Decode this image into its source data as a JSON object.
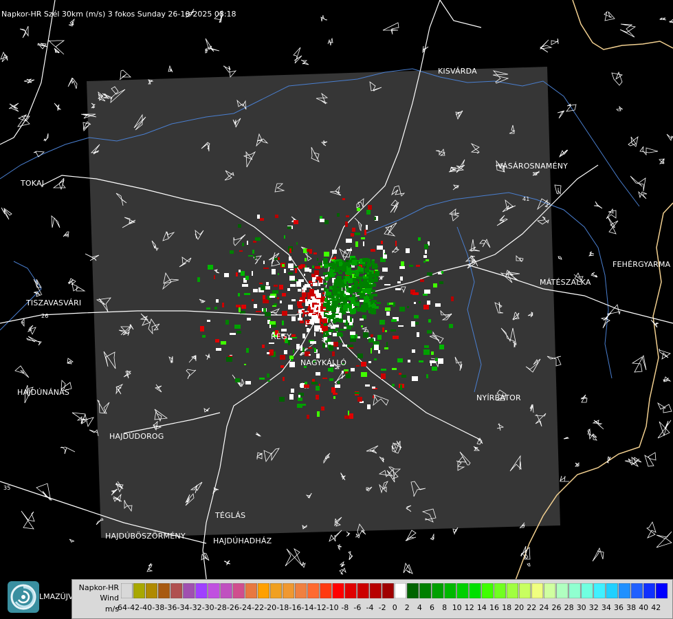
{
  "header": {
    "title": "Napkor-HR Szél 30km (m/s) 3 fokos Sunday 26-10-2025 08:18"
  },
  "places": [
    {
      "id": "kisvarda",
      "name": "KISVÁRDA"
    },
    {
      "id": "vasarosnameny",
      "name": "VÁSÁROSNAMÉNY"
    },
    {
      "id": "tokaj",
      "name": "TOKAJ"
    },
    {
      "id": "fehergyarmat",
      "name": "FEHÉRGYARMA"
    },
    {
      "id": "mateszalka",
      "name": "MÁTÉSZALKA"
    },
    {
      "id": "tiszavasvari",
      "name": "TISZAVASVÁRI"
    },
    {
      "id": "nyiregyhaza",
      "name": "REGY"
    },
    {
      "id": "nagykallo",
      "name": "NAGYKÁLLÓ"
    },
    {
      "id": "nyirbator",
      "name": "NYÍRBÁTOR"
    },
    {
      "id": "hajdunanas",
      "name": "HAJDÚNÁNÁS"
    },
    {
      "id": "hajdudorog",
      "name": "HAJDÚDOROG"
    },
    {
      "id": "teglas",
      "name": "TÉGLÁS"
    },
    {
      "id": "hajduboszormeny",
      "name": "HAJDÚBÖSZÖRMÉNY"
    },
    {
      "id": "hajduhadhaz",
      "name": "HAJDÚHADHÁZ"
    }
  ],
  "road_numbers": [
    "26",
    "41",
    "35"
  ],
  "logo": {
    "text": "LMAZÚJVÁR",
    "icon": "radar-logo-icon"
  },
  "legend": {
    "line1": "Napkor-HR",
    "line2": "Wind",
    "line3": "m/s",
    "ticks": [
      "-64",
      "-42",
      "-40",
      "-38",
      "-36",
      "-34",
      "-32",
      "-30",
      "-28",
      "-26",
      "-24",
      "-22",
      "-20",
      "-18",
      "-16",
      "-14",
      "-12",
      "-10",
      "-8",
      "-6",
      "-4",
      "-2",
      "0",
      "2",
      "4",
      "6",
      "8",
      "10",
      "12",
      "14",
      "16",
      "18",
      "20",
      "22",
      "24",
      "26",
      "28",
      "30",
      "32",
      "34",
      "36",
      "38",
      "40",
      "42"
    ],
    "colors": [
      "#d8d8d8",
      "#a8a800",
      "#b08a00",
      "#a85a10",
      "#b05050",
      "#a050b0",
      "#a040ff",
      "#c050e0",
      "#c050c0",
      "#d04e8e",
      "#e87840",
      "#ffa000",
      "#f0a020",
      "#f09830",
      "#f08040",
      "#ff6a30",
      "#ff3a10",
      "#ff0000",
      "#e00000",
      "#cc0000",
      "#b80000",
      "#a00000",
      "#ffffff",
      "#006400",
      "#008000",
      "#00a000",
      "#00b800",
      "#00d000",
      "#00e000",
      "#40ff00",
      "#70ff20",
      "#a0ff40",
      "#c8ff60",
      "#f0ff80",
      "#d0ffa0",
      "#b0ffc0",
      "#90ffd0",
      "#70ffe0",
      "#40f0ff",
      "#20d0ff",
      "#2090ff",
      "#2060ff",
      "#1030ff",
      "#0000ff"
    ]
  },
  "colors": {
    "radar_area": "#363636",
    "coast_boundary": "#f2d090",
    "rivers": "#4a7fd0",
    "roads": "#ffffff"
  }
}
